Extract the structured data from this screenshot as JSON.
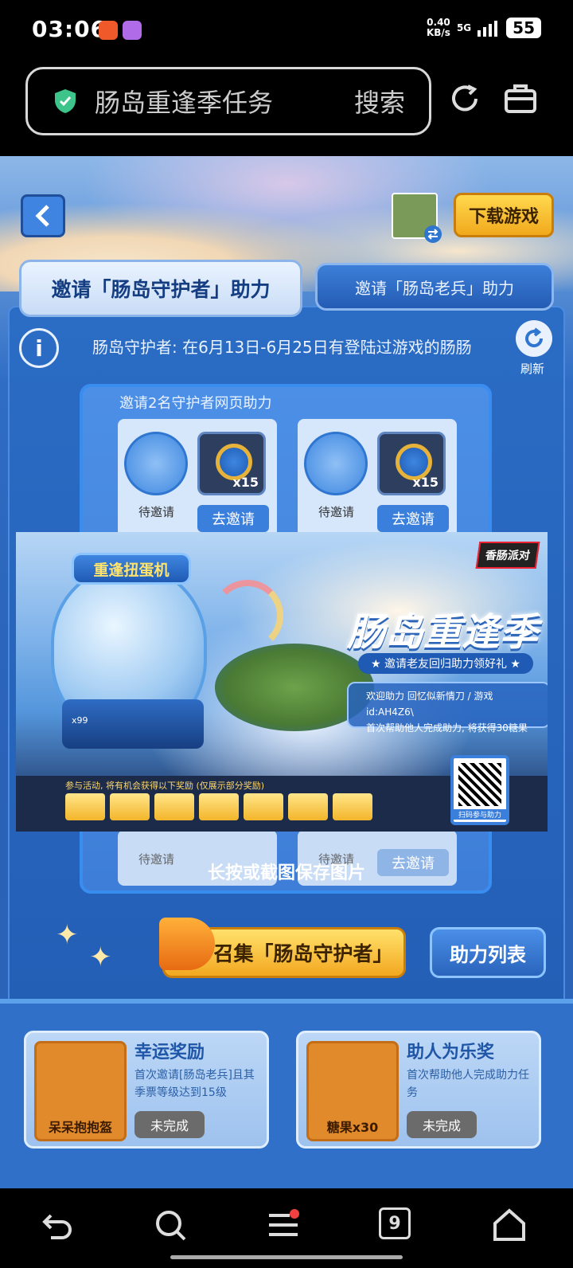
{
  "status_bar": {
    "time": "03:06",
    "net_speed": "0.40",
    "net_unit": "KB/s",
    "signal": "5G",
    "battery": "55"
  },
  "browser": {
    "url_title": "肠岛重逢季任务",
    "search_label": "搜索"
  },
  "header": {
    "download_label": "下载游戏"
  },
  "tabs": [
    {
      "label": "邀请「肠岛守护者」助力"
    },
    {
      "label": "邀请「肠岛老兵」助力"
    }
  ],
  "info": {
    "text": "肠岛守护者: 在6月13日-6月25日有登陆过游戏的肠肠",
    "refresh_label": "刷新"
  },
  "invite": {
    "title": "邀请2名守护者网页助力",
    "slots": [
      {
        "status": "待邀请",
        "qty": "x15",
        "action": "去邀请"
      },
      {
        "status": "待邀请",
        "qty": "x15",
        "action": "去邀请"
      }
    ],
    "bottom_status": "待邀请",
    "bottom_action": "去邀请"
  },
  "poster": {
    "machine_sign": "重逢扭蛋机",
    "logo": "香肠派对",
    "title": "肠岛重逢季",
    "subtitle": "★ 邀请老友回归助力领好礼 ★",
    "box_line1": "欢迎助力 回忆似新情刀 / 游戏id:AH4Z6\\",
    "box_line2": "首次帮助他人完成助力, 将获得30糖果",
    "note": "参与活动, 将有机会获得以下奖励 (仅展示部分奖励)",
    "qr_label": "扫码参与助力",
    "coin_count": "x99"
  },
  "save_tip": "长按或截图保存图片",
  "actions": {
    "gather_label": "召集「肠岛守护者」",
    "list_label": "助力列表"
  },
  "rewards": [
    {
      "thumb_label": "呆呆抱抱盔",
      "title": "幸运奖励",
      "desc": "首次邀请[肠岛老兵]且其季票等级达到15级",
      "status": "未完成"
    },
    {
      "thumb_label": "糖果x30",
      "title": "助人为乐奖",
      "desc": "首次帮助他人完成助力任务",
      "status": "未完成"
    }
  ],
  "nav": {
    "tabs_count": "9"
  },
  "colors": {
    "accent": "#2b6cc4",
    "gold": "#f3a820"
  }
}
